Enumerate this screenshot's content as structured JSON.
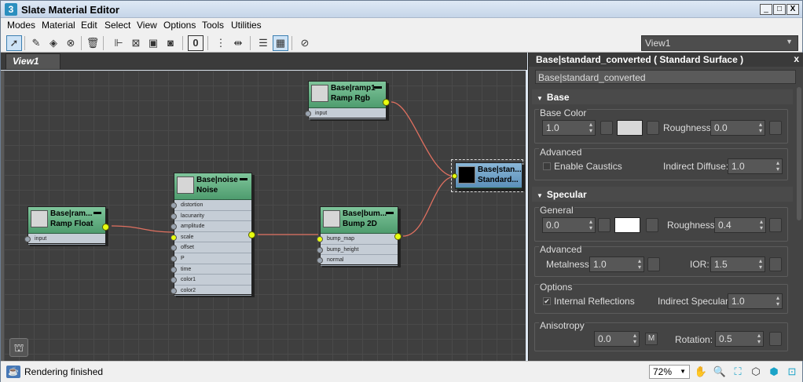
{
  "window": {
    "title": "Slate Material Editor",
    "icon": "3ds-max-icon",
    "controls": [
      "_",
      "□",
      "X"
    ]
  },
  "menu": [
    "Modes",
    "Material",
    "Edit",
    "Select",
    "View",
    "Options",
    "Tools",
    "Utilities"
  ],
  "toolbar": {
    "icons": [
      "select-arrow-icon",
      "eyedropper-icon",
      "assign-material-icon",
      "put-to-scene-icon",
      "delete-icon",
      "layout-icon",
      "move-children-icon",
      "hide-unused-icon",
      "show-map-icon",
      "show-background-icon",
      "material-id-icon",
      "layout-all-icon",
      "layout-children-icon",
      "parameter-editor-icon",
      "select-by-material-icon",
      "navigator-icon"
    ],
    "material_id": "0",
    "view_select": "View1"
  },
  "view": {
    "tab": "View1"
  },
  "nodes": [
    {
      "id": "ramp-rgb",
      "name": "Base|ramp1",
      "type": "Ramp Rgb",
      "slots": [
        "input"
      ],
      "color": "#5aa878"
    },
    {
      "id": "noise",
      "name": "Base|noise",
      "type": "Noise",
      "slots": [
        "distortion",
        "lacunarity",
        "amplitude",
        "scale",
        "offset",
        "P",
        "time",
        "color1",
        "color2"
      ],
      "color": "#5aa878"
    },
    {
      "id": "ramp-float",
      "name": "Base|ram...",
      "type": "Ramp Float",
      "slots": [
        "input"
      ],
      "color": "#5aa878"
    },
    {
      "id": "bump2d",
      "name": "Base|bum...",
      "type": "Bump 2D",
      "slots": [
        "bump_map",
        "bump_height",
        "normal"
      ],
      "color": "#5aa878"
    },
    {
      "id": "standard",
      "name": "Base|stan...",
      "type": "Standard...",
      "slots": [],
      "color": "#6a9cc4"
    }
  ],
  "panel": {
    "title": "Base|standard_converted  ( Standard Surface )",
    "material_name": "Base|standard_converted",
    "base": {
      "section": "Base",
      "base_color_label": "Base Color",
      "weight": "1.0",
      "color": "#d8d8d8",
      "roughness_label": "Roughness:",
      "roughness": "0.0",
      "advanced_label": "Advanced",
      "caustics_label": "Enable Caustics",
      "indirect_diffuse_label": "Indirect Diffuse:",
      "indirect_diffuse": "1.0"
    },
    "specular": {
      "section": "Specular",
      "general_label": "General",
      "weight": "0.0",
      "color": "#ffffff",
      "roughness_label": "Roughness:",
      "roughness": "0.4",
      "advanced_label": "Advanced",
      "metalness_label": "Metalness:",
      "metalness": "1.0",
      "ior_label": "IOR:",
      "ior": "1.5",
      "options_label": "Options",
      "internal_reflections_label": "Internal Reflections",
      "internal_reflections_checked": "✔",
      "indirect_specular_label": "Indirect Specular:",
      "indirect_specular": "1.0",
      "anisotropy_label": "Anisotropy",
      "anisotropy": "0.0",
      "map_button": "M",
      "rotation_label": "Rotation:",
      "rotation": "0.5"
    }
  },
  "status": {
    "text": "Rendering finished",
    "zoom": "72%",
    "nav_icons": [
      "pan-hand-icon",
      "zoom-magnifier-icon",
      "zoom-region-icon",
      "zoom-extents-icon",
      "zoom-extents-selected-icon",
      "zoom-selected-icon",
      "frame-all-icon"
    ]
  }
}
